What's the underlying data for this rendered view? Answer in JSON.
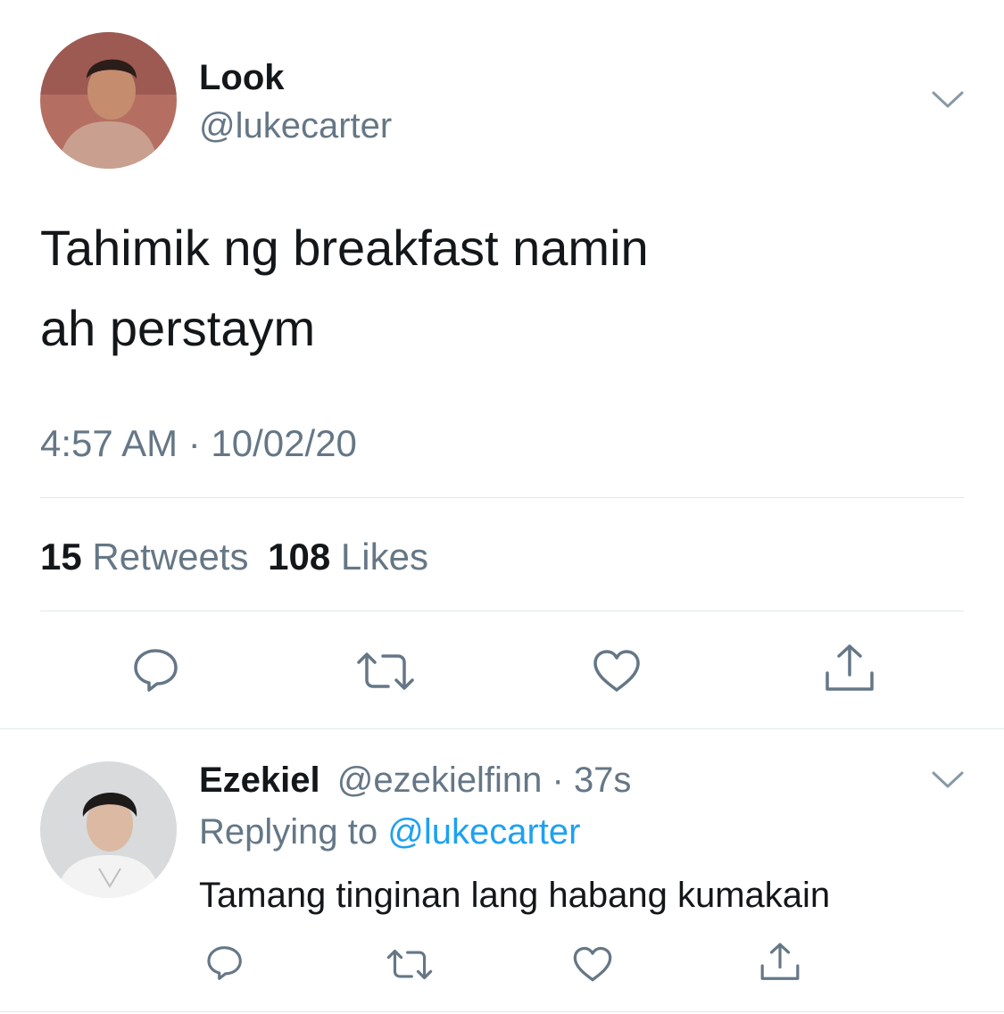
{
  "tweet": {
    "display_name": "Look",
    "handle": "@lukecarter",
    "text_line1": "Tahimik ng breakfast namin",
    "text_line2": "ah perstaym",
    "timestamp": "4:57 AM · 10/02/20",
    "retweet_count": "15",
    "retweet_label": "Retweets",
    "like_count": "108",
    "like_label": "Likes",
    "actions": [
      "reply-icon",
      "retweet-icon",
      "like-icon",
      "share-icon"
    ]
  },
  "reply": {
    "display_name": "Ezekiel",
    "handle_time": "@ezekielfinn · 37s",
    "replying_to_label": "Replying to",
    "replying_to_handle": "@lukecarter",
    "text": "Tamang tinginan lang habang kumakain",
    "actions": [
      "reply-icon",
      "retweet-icon",
      "like-icon",
      "share-icon"
    ]
  },
  "colors": {
    "text": "#14171a",
    "secondary": "#657786",
    "link": "#1da1f2",
    "divider": "#e1e8ed"
  }
}
